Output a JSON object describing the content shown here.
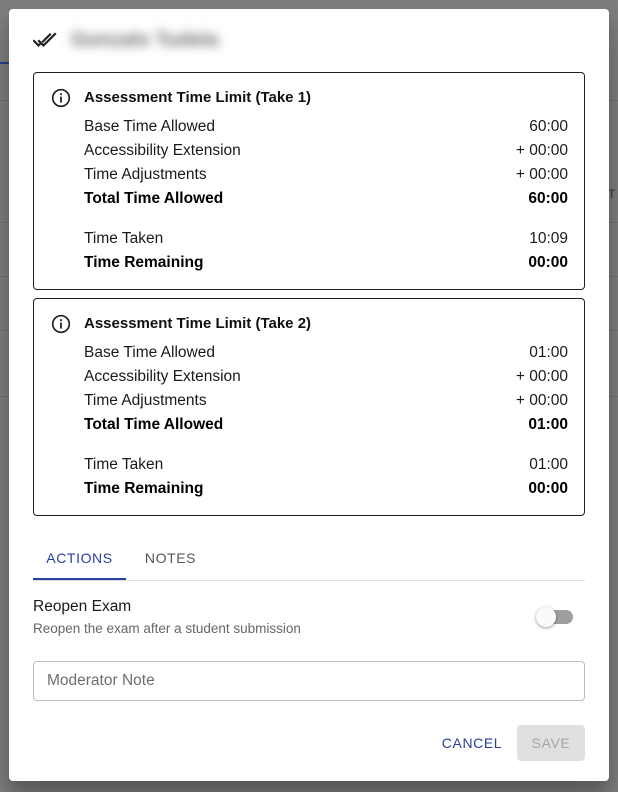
{
  "header": {
    "student_name": "Gonzalo Tudela",
    "icon": "done-all-icon"
  },
  "background": {
    "edge_letter": "T"
  },
  "takes": [
    {
      "title": "Assessment Time Limit (Take 1)",
      "rows": [
        {
          "label": "Base Time Allowed",
          "value": "60:00"
        },
        {
          "label": "Accessibility Extension",
          "value": "+ 00:00"
        },
        {
          "label": "Time Adjustments",
          "value": "+ 00:00"
        },
        {
          "label": "Total Time Allowed",
          "value": "60:00"
        },
        {
          "label": "Time Taken",
          "value": "10:09"
        },
        {
          "label": "Time Remaining",
          "value": "00:00"
        }
      ]
    },
    {
      "title": "Assessment Time Limit (Take 2)",
      "rows": [
        {
          "label": "Base Time Allowed",
          "value": "01:00"
        },
        {
          "label": "Accessibility Extension",
          "value": "+ 00:00"
        },
        {
          "label": "Time Adjustments",
          "value": "+ 00:00"
        },
        {
          "label": "Total Time Allowed",
          "value": "01:00"
        },
        {
          "label": "Time Taken",
          "value": "01:00"
        },
        {
          "label": "Time Remaining",
          "value": "00:00"
        }
      ]
    }
  ],
  "tabs": {
    "actions": "ACTIONS",
    "notes": "NOTES",
    "active": "actions"
  },
  "reopen": {
    "title": "Reopen Exam",
    "subtitle": "Reopen the exam after a student submission",
    "enabled": false
  },
  "moderator_note": {
    "placeholder": "Moderator Note",
    "value": ""
  },
  "buttons": {
    "cancel": "CANCEL",
    "save": "SAVE",
    "save_disabled": true
  },
  "colors": {
    "accent": "#2c3e9e",
    "disabled_bg": "#e0e0e0",
    "disabled_text": "#a6a6a6"
  }
}
